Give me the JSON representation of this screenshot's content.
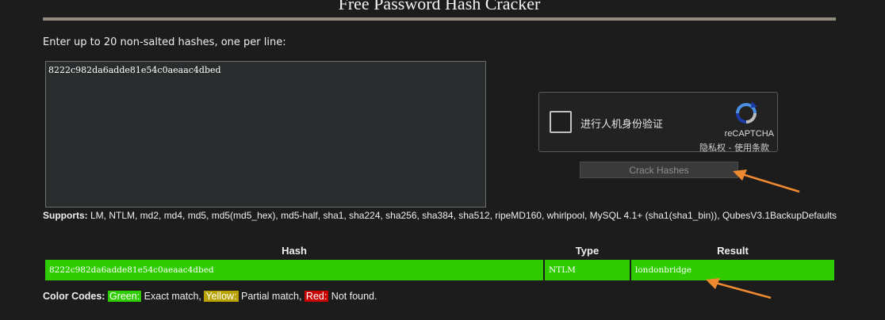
{
  "page": {
    "title": "Free Password Hash Cracker"
  },
  "form": {
    "prompt": "Enter up to 20 non-salted hashes, one per line:",
    "input_value": "8222c982da6adde81e54c0aeaac4dbed",
    "crack_button": "Crack Hashes"
  },
  "captcha": {
    "label": "进行人机身份验证",
    "brand": "reCAPTCHA",
    "terms": "隐私权 - 使用条款",
    "logo_icon": "recaptcha-icon"
  },
  "supports": {
    "label": "Supports:",
    "text": " LM, NTLM, md2, md4, md5, md5(md5_hex), md5-half, sha1, sha224, sha256, sha384, sha512, ripeMD160, whirlpool, MySQL 4.1+ (sha1(sha1_bin)), QubesV3.1BackupDefaults"
  },
  "results": {
    "columns": [
      "Hash",
      "Type",
      "Result"
    ],
    "rows": [
      {
        "hash": "8222c982da6adde81e54c0aeaac4dbed",
        "type": "NTLM",
        "result": "londonbridge",
        "status_color": "#2ecc00"
      }
    ]
  },
  "color_codes": {
    "label": "Color Codes:",
    "green": "Green:",
    "green_text": " Exact match, ",
    "yellow": "Yellow:",
    "yellow_text": " Partial match, ",
    "red": "Red:",
    "red_text": " Not found."
  },
  "colors": {
    "background": "#1c1c1c",
    "match": "#2ecc00",
    "partial": "#b7a200",
    "notfound": "#cc0000",
    "annotation_arrow": "#f08a30"
  }
}
